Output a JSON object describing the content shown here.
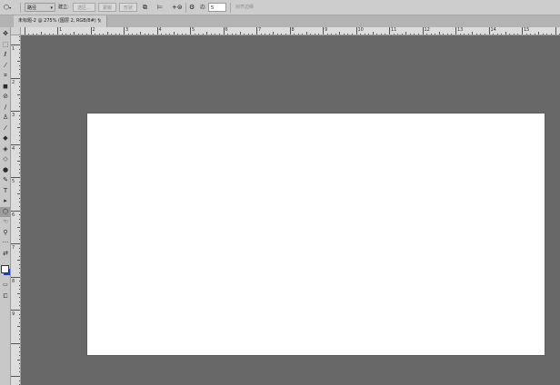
{
  "options_bar": {
    "path_mode": "路径",
    "make_label": "建立:",
    "selection_btn": "选区...",
    "mask_btn": "蒙版",
    "shape_btn": "形状",
    "radius_label": "边:",
    "radius_value": "5",
    "align_edges": "对齐边缘"
  },
  "document_tab": {
    "title": "未标题-2 @ 275% (图层 2, RGB/8#) *",
    "close_icon": "×"
  },
  "toolbox": {
    "tools": [
      {
        "name": "move",
        "glyph": "✥"
      },
      {
        "name": "marquee",
        "glyph": "⬚"
      },
      {
        "name": "lasso",
        "glyph": "ℓ"
      },
      {
        "name": "quick-select",
        "glyph": "⁄"
      },
      {
        "name": "crop",
        "glyph": "⌗"
      },
      {
        "name": "eyedropper",
        "glyph": "◼"
      },
      {
        "name": "healing",
        "glyph": "⊘"
      },
      {
        "name": "brush",
        "glyph": "∕"
      },
      {
        "name": "stamp",
        "glyph": "♙"
      },
      {
        "name": "history-brush",
        "glyph": "⁄"
      },
      {
        "name": "eraser",
        "glyph": "◆"
      },
      {
        "name": "bucket",
        "glyph": "◈"
      },
      {
        "name": "blur",
        "glyph": "◇"
      },
      {
        "name": "dodge",
        "glyph": "●"
      },
      {
        "name": "pen",
        "glyph": "✎"
      },
      {
        "name": "type",
        "glyph": "T"
      },
      {
        "name": "path-select",
        "glyph": "▸"
      },
      {
        "name": "polygon",
        "glyph": "⬡"
      },
      {
        "name": "hand",
        "glyph": "☜"
      },
      {
        "name": "zoom",
        "glyph": "⚲"
      },
      {
        "name": "more",
        "glyph": "···"
      },
      {
        "name": "swap",
        "glyph": "⇄"
      }
    ],
    "fg_color": "#ffffff",
    "bg_color": "#1a3de6"
  },
  "ruler": {
    "h_labels": [
      "1",
      "2",
      "3",
      "4",
      "5",
      "6",
      "7",
      "8",
      "9",
      "10",
      "11",
      "12",
      "13",
      "14",
      "15"
    ],
    "v_labels": [
      "1",
      "2",
      "3",
      "4",
      "5",
      "6",
      "7",
      "8",
      "9"
    ]
  },
  "colors": {
    "workspace": "#686868",
    "canvas": "#ffffff"
  }
}
